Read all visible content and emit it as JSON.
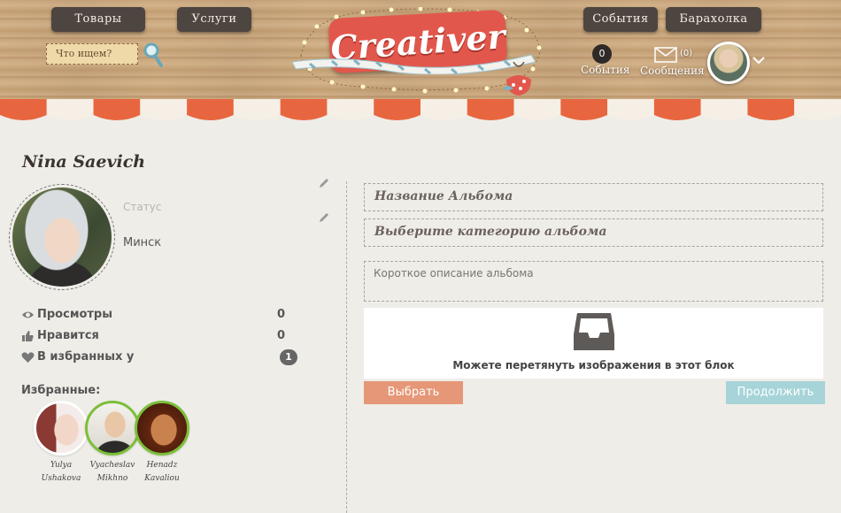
{
  "header": {
    "nav_left": [
      "Товары",
      "Услуги"
    ],
    "nav_right": [
      "События",
      "Барахолка"
    ],
    "search_placeholder": "Что ищем?",
    "logo_text": "Creativer",
    "events_count": "0",
    "events_label": "События",
    "messages_count": "(0)",
    "messages_label": "Сообщения"
  },
  "profile": {
    "name": "Nina Saevich",
    "status_placeholder": "Статус",
    "city": "Минск",
    "stats": [
      {
        "icon": "eye-icon",
        "label": "Просмотры",
        "value": "0"
      },
      {
        "icon": "thumbs-up-icon",
        "label": "Нравится",
        "value": "0"
      },
      {
        "icon": "heart-icon",
        "label": "В избранных у",
        "value": "1"
      }
    ],
    "favorites_title": "Избранные:",
    "favorites": [
      {
        "first": "Yulya",
        "last": "Ushakova"
      },
      {
        "first": "Vyacheslav",
        "last": "Mikhno"
      },
      {
        "first": "Henadz",
        "last": "Kavaliou"
      }
    ]
  },
  "album_form": {
    "name_placeholder": "Название Альбома",
    "category_placeholder": "Выберите категорию альбома",
    "description_placeholder": "Короткое описание альбома",
    "dropzone_text": "Можете перетянуть изображения в этот блок",
    "choose_button": "Выбрать",
    "continue_button": "Продолжить"
  },
  "colors": {
    "logo_red": "#e2574c",
    "choose_button": "#e59778",
    "continue_button": "#a6d4d8",
    "nav_button": "#4d4540"
  }
}
